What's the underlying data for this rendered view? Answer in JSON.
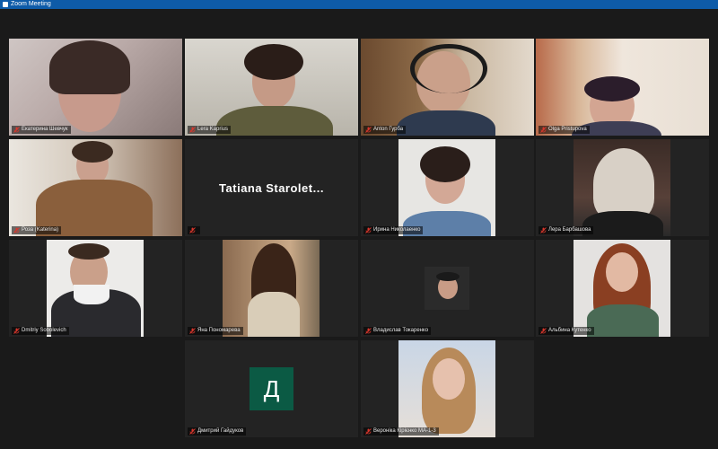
{
  "window": {
    "title": "Zoom Meeting"
  },
  "colors": {
    "titlebar": "#0e5ba8",
    "active_border": "#c8d94a",
    "mute": "#d8372c",
    "avatar_bg": "#0b5a44"
  },
  "participants": [
    {
      "name": "Екатерина Шевчук",
      "muted": true
    },
    {
      "name": "Lera Kaprius",
      "muted": true
    },
    {
      "name": "Anton Гурба",
      "muted": true
    },
    {
      "name": "Olga Pristupova",
      "muted": true
    },
    {
      "name": "Роза (Katerina)",
      "muted": true,
      "active_speaker": true
    },
    {
      "name": "Tatiana Starolet...",
      "muted": true,
      "video_off": true
    },
    {
      "name": "Ирина Николаенко",
      "muted": true
    },
    {
      "name": "Лера Барбашова",
      "muted": true
    },
    {
      "name": "Dmitriy Sobolevich",
      "muted": true
    },
    {
      "name": "Яна Пономарева",
      "muted": true
    },
    {
      "name": "Владислав Токаренко",
      "muted": true
    },
    {
      "name": "Альбина Кутенко",
      "muted": true
    },
    {
      "name": "Дмитрий Гайдуков",
      "muted": true,
      "avatar_letter": "Д"
    },
    {
      "name": "Вероніка Кірієнко МА-1-3",
      "muted": true
    }
  ]
}
